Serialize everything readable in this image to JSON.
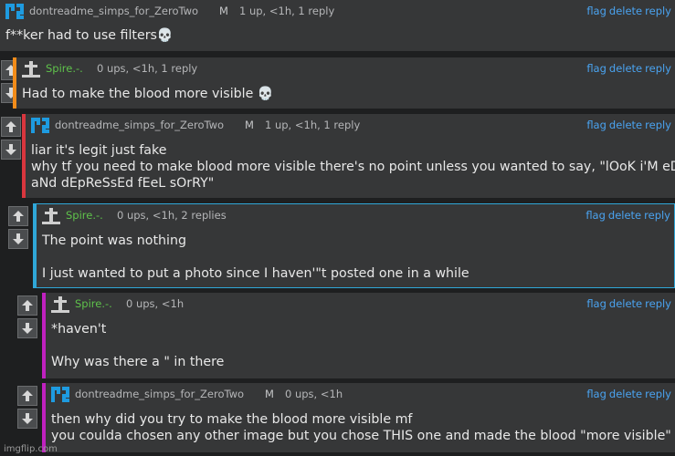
{
  "comments": [
    {
      "user": "dontreadme_simps_for_ZeroTwo",
      "badge": "M",
      "stats": "1 up, <1h, 1 reply",
      "text_lines": [
        "f**ker had to use filters💀"
      ],
      "border_color": "#3a3b3c",
      "user_color": "#b5b6b8",
      "icon": "pixel-avatar-icon",
      "actions": [
        "flag",
        "delete",
        "reply"
      ]
    },
    {
      "user": "Spire.-.",
      "badge": "",
      "stats": "0 ups, <1h, 1 reply",
      "text_lines": [
        "Had to make the blood more visible 💀"
      ],
      "border_color": "#f28c1a",
      "user_color": "#5fc24b",
      "icon": "grave-cross-icon",
      "actions": [
        "flag",
        "delete",
        "reply"
      ]
    },
    {
      "user": "dontreadme_simps_for_ZeroTwo",
      "badge": "M",
      "stats": "1 up, <1h, 1 reply",
      "text_lines": [
        "liar it's legit just fake",
        "why tf you need to make blood more visible there's no point unless you wanted to say, \"lOoK i'M eDgY",
        "aNd dEpReSsEd fEeL sOrRY\""
      ],
      "border_color": "#d9363e",
      "user_color": "#b5b6b8",
      "icon": "pixel-avatar-icon",
      "actions": [
        "flag",
        "delete",
        "reply"
      ]
    },
    {
      "user": "Spire.-.",
      "badge": "",
      "stats": "0 ups, <1h, 2 replies",
      "text_lines": [
        "The point was nothing",
        "",
        "I just wanted to put a photo since I haven'\"t posted one in a while"
      ],
      "border_color": "#2fa7d8",
      "user_color": "#5fc24b",
      "icon": "grave-cross-icon",
      "actions": [
        "flag",
        "delete",
        "reply"
      ]
    },
    {
      "user": "Spire.-.",
      "badge": "",
      "stats": "0 ups, <1h",
      "text_lines": [
        "*haven't",
        "",
        "Why was there a \" in there"
      ],
      "border_color": "#c021c0",
      "user_color": "#5fc24b",
      "icon": "grave-cross-icon",
      "actions": [
        "flag",
        "delete",
        "reply"
      ]
    },
    {
      "user": "dontreadme_simps_for_ZeroTwo",
      "badge": "M",
      "stats": "0 ups, <1h",
      "text_lines": [
        "then why did you try to make the blood more visible mf",
        "you coulda chosen any other image but you chose THIS one and made the blood \"more visible\""
      ],
      "border_color": "#c021c0",
      "user_color": "#b5b6b8",
      "icon": "pixel-avatar-icon",
      "actions": [
        "flag",
        "delete",
        "reply"
      ]
    }
  ],
  "watermark": "imgflip.com"
}
